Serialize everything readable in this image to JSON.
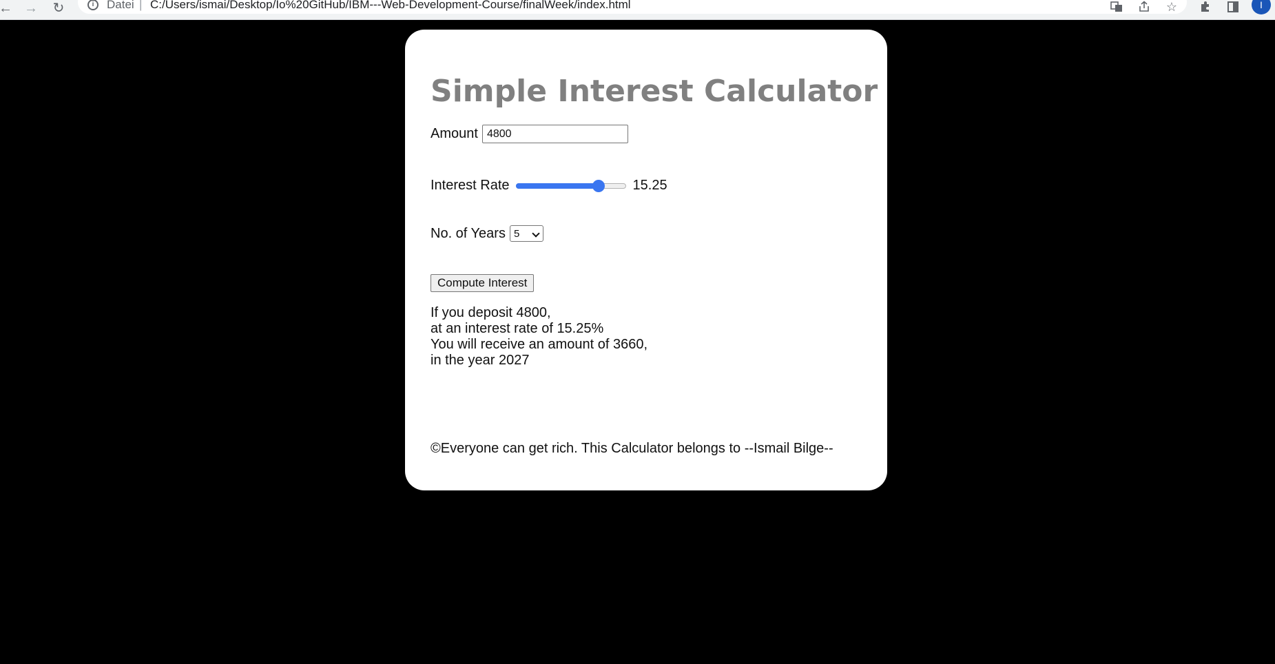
{
  "browser": {
    "url_scheme_label": "Datei",
    "url_separator": "|",
    "url": "C:/Users/ismai/Desktop/Io%20GitHub/IBM---Web-Development-Course/finalWeek/index.html",
    "avatar_letter": "I",
    "icons": [
      "back-icon",
      "forward-icon",
      "reload-icon",
      "info-icon",
      "translate-icon",
      "share-icon",
      "star-icon",
      "extensions-icon",
      "side-panel-icon"
    ]
  },
  "app": {
    "title": "Simple Interest Calculator",
    "amount_label": "Amount",
    "amount_value": "4800",
    "rate_label": "Interest Rate",
    "rate_value": "15.25",
    "rate_slider": {
      "min": 1,
      "max": 20,
      "value": 15.25,
      "fill_color": "#3a76f0"
    },
    "years_label": "No. of Years",
    "years_selected": "5",
    "compute_label": "Compute Interest",
    "result": {
      "line1": "If you deposit 4800,",
      "line2": "at an interest rate of 15.25%",
      "line3": "You will receive an amount of 3660,",
      "line4": "in the year 2027"
    },
    "footer": "©Everyone can get rich. This Calculator belongs to --Ismail Bilge--"
  },
  "colors": {
    "page_background": "#000000",
    "card_background": "#ffffff",
    "title": "#808080",
    "accent": "#3a76f0"
  }
}
